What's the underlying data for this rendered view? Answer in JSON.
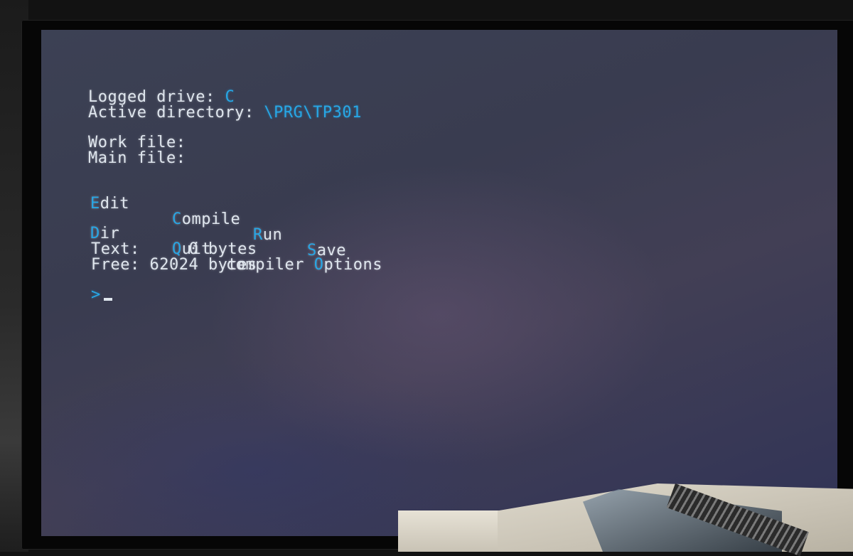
{
  "status": {
    "logged_drive_label": "Logged drive:",
    "logged_drive_value": "C",
    "active_directory_label": "Active directory:",
    "active_directory_value": "\\PRG\\TP301"
  },
  "files": {
    "work_file_label": "Work file:",
    "main_file_label": "Main file:"
  },
  "menu": {
    "edit": {
      "key": "E",
      "rest": "dit"
    },
    "compile": {
      "key": "C",
      "rest": "ompile"
    },
    "run": {
      "key": "R",
      "rest": "un"
    },
    "save": {
      "key": "S",
      "rest": "ave"
    },
    "dir": {
      "key": "D",
      "rest": "ir"
    },
    "quit": {
      "key": "Q",
      "rest": "uit"
    },
    "compiler_options": {
      "prefix": "compiler ",
      "key": "O",
      "rest": "ptions"
    }
  },
  "memory": {
    "text_line": "Text:     0 bytes",
    "free_line": "Free: 62024 bytes"
  },
  "prompt": {
    "symbol": ">"
  },
  "colors": {
    "text": "#dfe6ee",
    "highlight": "#27a7e6",
    "screen_bg": "#3a3d51"
  }
}
